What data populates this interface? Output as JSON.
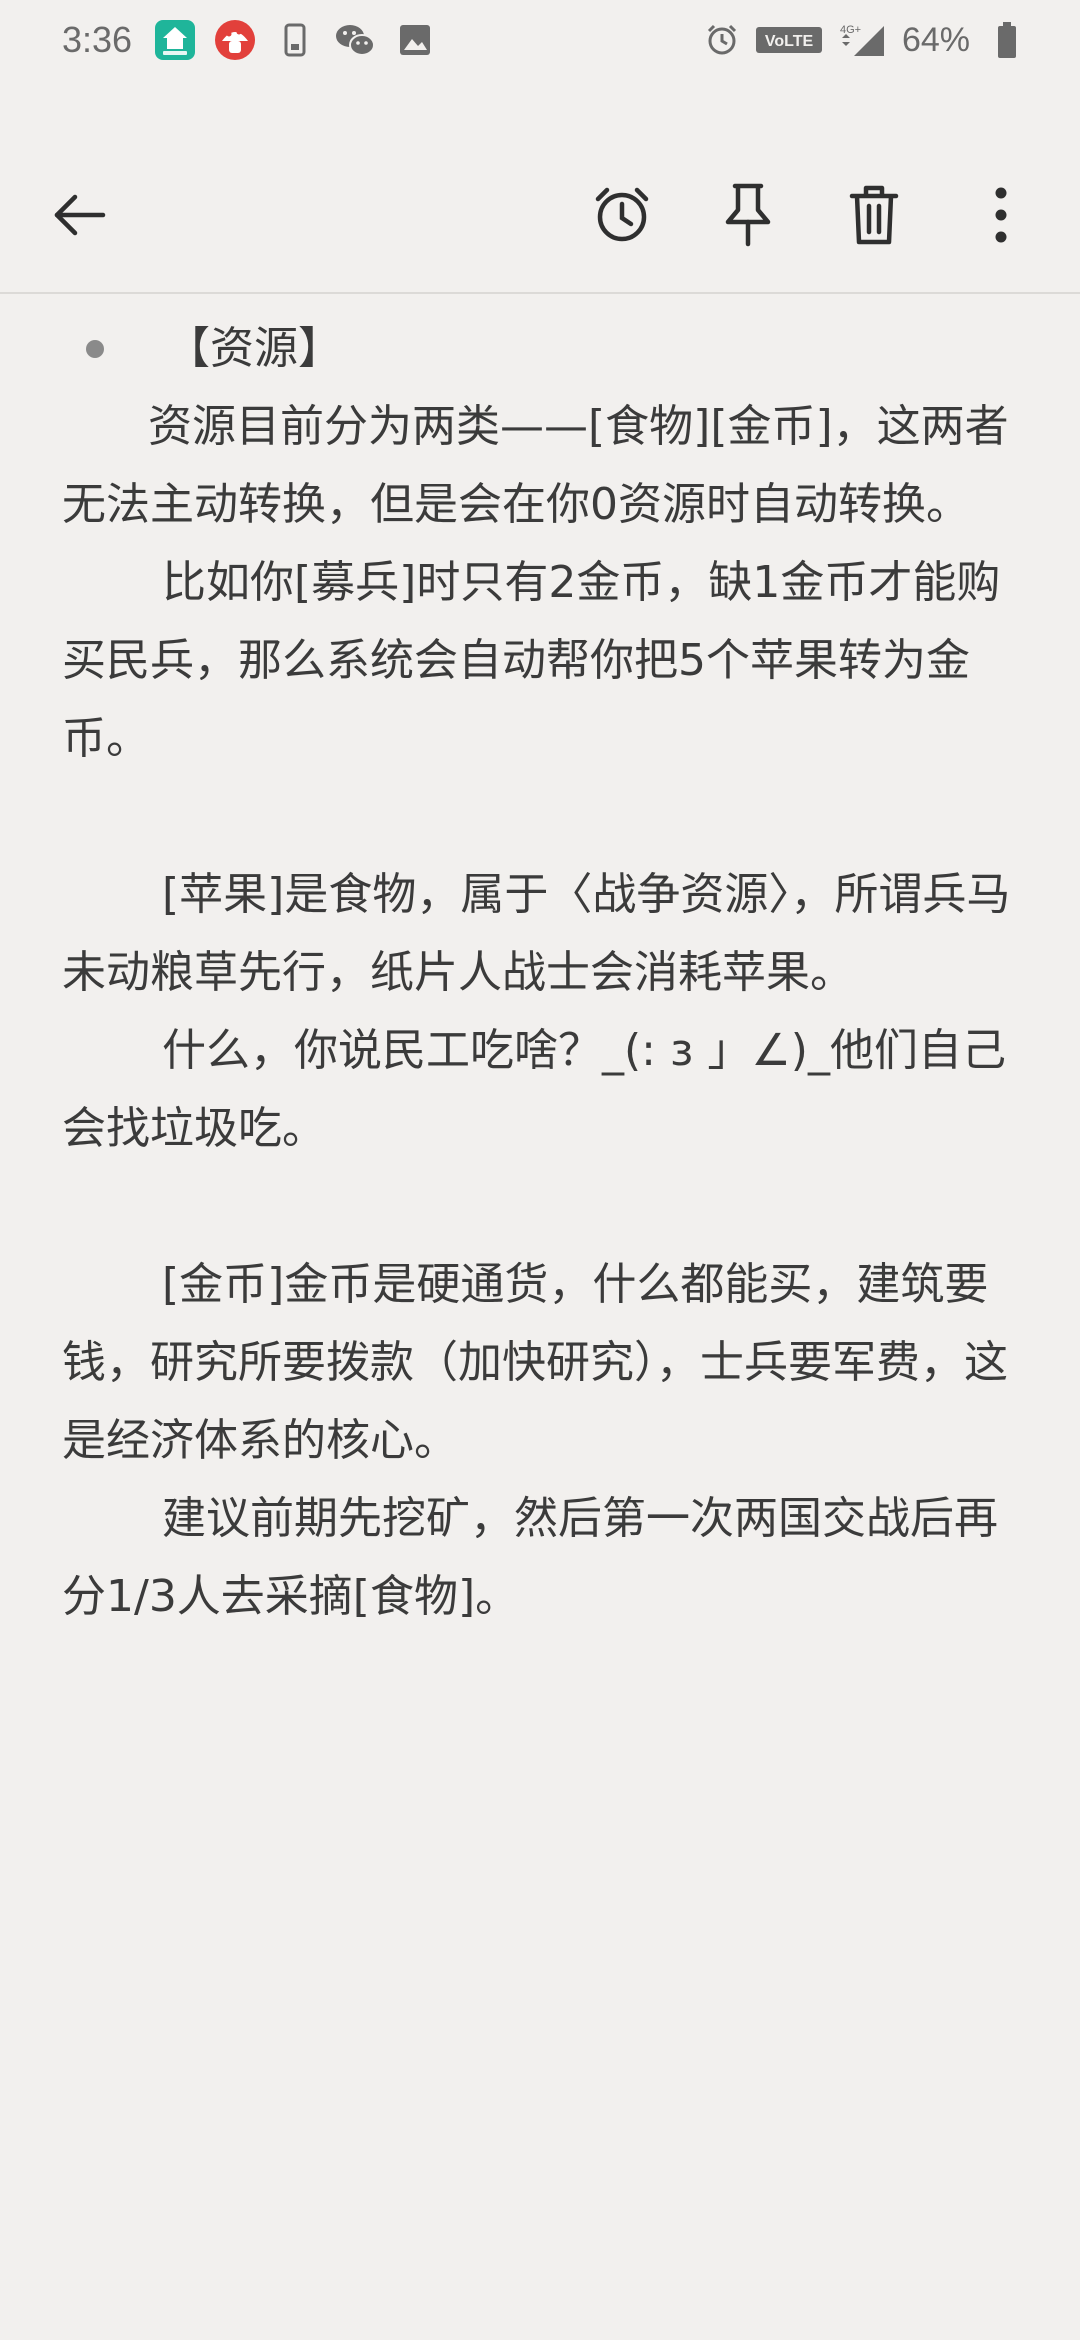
{
  "status_bar": {
    "time": "3:36",
    "battery": "64%",
    "network": "VoLTE",
    "signal_label": "4G+",
    "notif_icons": [
      "home-app-icon",
      "mushroom-app-icon",
      "phone-icon",
      "wechat-icon",
      "image-icon"
    ],
    "right_icons": [
      "alarm-icon",
      "volte-icon",
      "signal-icon",
      "battery-icon"
    ]
  },
  "toolbar": {
    "back_icon": "back-arrow-icon",
    "actions": [
      "alarm-icon",
      "pin-icon",
      "trash-icon",
      "more-icon"
    ]
  },
  "note": {
    "heading": "【资源】",
    "paragraphs": [
      "资源目前分为两类——[食物][金币]，这两者无法主动转换，但是会在你0资源时自动转换。",
      "比如你[募兵]时只有2金币，缺1金币才能购买民兵，那么系统会自动帮你把5个苹果转为金币。",
      "",
      "[苹果]是食物，属于〈战争资源〉，所谓兵马未动粮草先行，纸片人战士会消耗苹果。",
      "什么，你说民工吃啥？_(: з 」∠)_他们自己会找垃圾吃。",
      "",
      "[金币]金币是硬通货，什么都能买，建筑要钱，研究所要拨款（加快研究），士兵要军费，这是经济体系的核心。",
      "建议前期先挖矿，然后第一次两国交战后再分1/3人去采摘[食物]。"
    ]
  },
  "colors": {
    "background": "#f2f0ee",
    "text": "#3b3b3b",
    "icon": "#2f2f2f"
  }
}
